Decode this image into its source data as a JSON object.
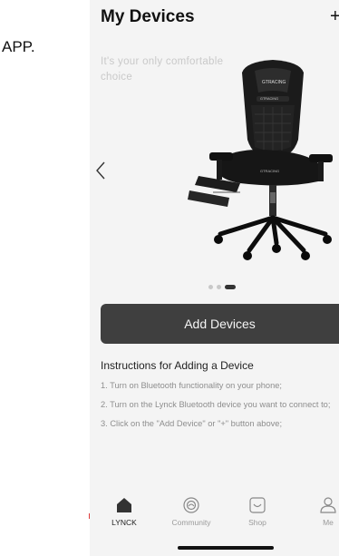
{
  "outside_label": "APP.",
  "header": {
    "title": "My Devices",
    "add_icon": "plus-icon"
  },
  "banner": {
    "tagline": "It's your only comfortable choice",
    "prev_icon": "chevron-left-icon",
    "image": "gaming-chair",
    "brand_text": "GTRACING",
    "carousel": {
      "total": 3,
      "active_index": 2
    }
  },
  "add_devices": {
    "label": "Add Devices"
  },
  "instructions": {
    "title": "Instructions for Adding a Device",
    "steps": [
      "1. Turn on Bluetooth functionality on your phone;",
      "2. Turn on the Lynck Bluetooth device you want to connect to;",
      "3. Click on the \"Add Device\" or \"+\" button above;"
    ]
  },
  "tabbar": {
    "tabs": [
      {
        "label": "LYNCK",
        "icon": "home-icon",
        "active": true
      },
      {
        "label": "Community",
        "icon": "community-icon",
        "active": false
      },
      {
        "label": "Shop",
        "icon": "shop-icon",
        "active": false
      },
      {
        "label": "Me",
        "icon": "user-icon",
        "active": false
      }
    ]
  },
  "colors": {
    "button_bg": "#3f3f3f",
    "page_bg": "#f4f4f4",
    "tagline": "#c9c9c9",
    "muted_text": "#8e8e8e"
  }
}
